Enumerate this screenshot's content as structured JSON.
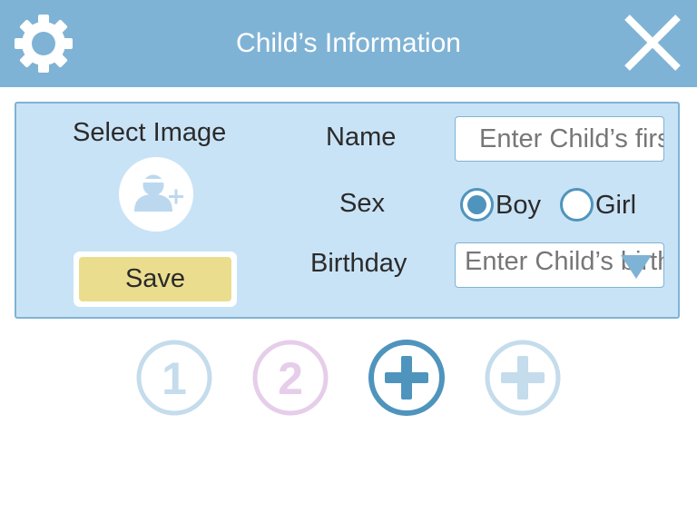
{
  "header": {
    "title": "Child’s Information",
    "settings_icon": "gear-icon",
    "close_icon": "close-icon"
  },
  "form": {
    "select_image_label": "Select Image",
    "avatar_icon": "add-user-icon",
    "save_label": "Save",
    "name_label": "Name",
    "name_placeholder": "Enter Child’s first name",
    "sex_label": "Sex",
    "sex_options": [
      {
        "label": "Boy",
        "selected": true
      },
      {
        "label": "Girl",
        "selected": false
      }
    ],
    "birthday_label": "Birthday",
    "birthday_placeholder": "Enter Child’s birthday",
    "birthday_icon": "dropdown-triangle-icon"
  },
  "children_selector": [
    {
      "label": "1",
      "color": "#c4dcec",
      "active": false
    },
    {
      "label": "2",
      "color": "#e6cdea",
      "active": false
    },
    {
      "label": "+",
      "color": "#4f94bd",
      "active": true
    },
    {
      "label": "+",
      "color": "#c4dcec",
      "active": false
    }
  ],
  "colors": {
    "header": "#7fb3d5",
    "panel": "#c9e3f6",
    "accent": "#4f94bd",
    "save": "#ebdd8e"
  }
}
